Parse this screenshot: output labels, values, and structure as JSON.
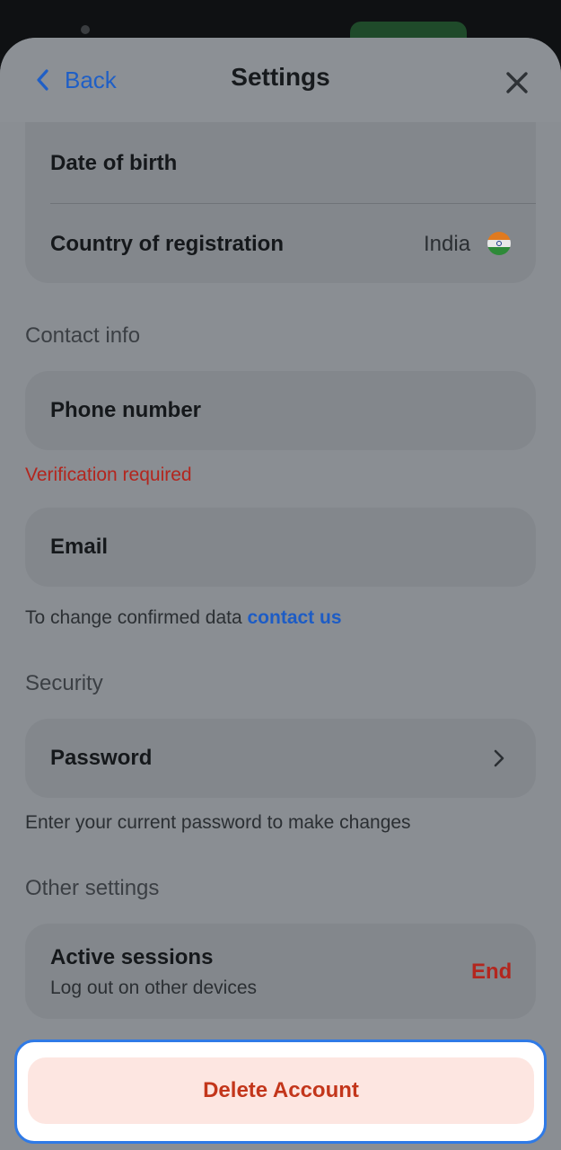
{
  "header": {
    "back_label": "Back",
    "title": "Settings"
  },
  "personal": {
    "date_of_birth_label": "Date of birth",
    "country_label": "Country of registration",
    "country_value": "India"
  },
  "contact": {
    "section_title": "Contact info",
    "phone_label": "Phone number",
    "verification_text": "Verification required",
    "email_label": "Email",
    "note_text": "To change confirmed data",
    "contact_link": "contact us"
  },
  "security": {
    "section_title": "Security",
    "password_label": "Password",
    "note_text": "Enter your current password to make changes"
  },
  "other": {
    "section_title": "Other settings",
    "active_sessions_label": "Active sessions",
    "active_sessions_sub": "Log out on other devices",
    "end_label": "End"
  },
  "footer": {
    "delete_label": "Delete Account"
  },
  "colors": {
    "accent": "#1f5fc6",
    "danger": "#c3361b",
    "highlight": "#2f7ae6"
  }
}
